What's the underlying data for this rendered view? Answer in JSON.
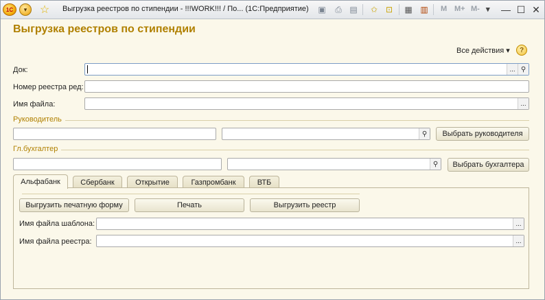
{
  "window": {
    "title": "Выгрузка реестров по стипендии - !!!WORK!!! / По...  (1С:Предприятие)",
    "logo_text": "1С",
    "memory_buttons": [
      "M",
      "M+",
      "M-"
    ]
  },
  "page": {
    "title": "Выгрузка реестров по стипендии",
    "all_actions": "Все действия ▾",
    "help": "?"
  },
  "form": {
    "doc_label": "Док:",
    "doc_value": "",
    "registry_number_label": "Номер реестра ред:",
    "registry_number_value": "",
    "file_name_label": "Имя файла:",
    "file_name_value": ""
  },
  "manager": {
    "group_title": "Руководитель",
    "name_value": "",
    "select_value": "",
    "select_button": "Выбрать руководителя"
  },
  "accountant": {
    "group_title": "Гл.бухгалтер",
    "name_value": "",
    "select_value": "",
    "select_button": "Выбрать бухгалтера"
  },
  "tabs": [
    {
      "label": "Альфабанк",
      "active": true
    },
    {
      "label": "Сбербанк",
      "active": false
    },
    {
      "label": "Открытие",
      "active": false
    },
    {
      "label": "Газпромбанк",
      "active": false
    },
    {
      "label": "ВТБ",
      "active": false
    }
  ],
  "panel": {
    "export_print_button": "Выгрузить печатную форму",
    "print_button": "Печать",
    "export_registry_button": "Выгрузить реестр",
    "template_label": "Имя файла шаблона:",
    "template_value": "",
    "registry_file_label": "Имя файла реестра:",
    "registry_file_value": ""
  },
  "icons": {
    "ellipsis": "...",
    "search": "🔍"
  }
}
